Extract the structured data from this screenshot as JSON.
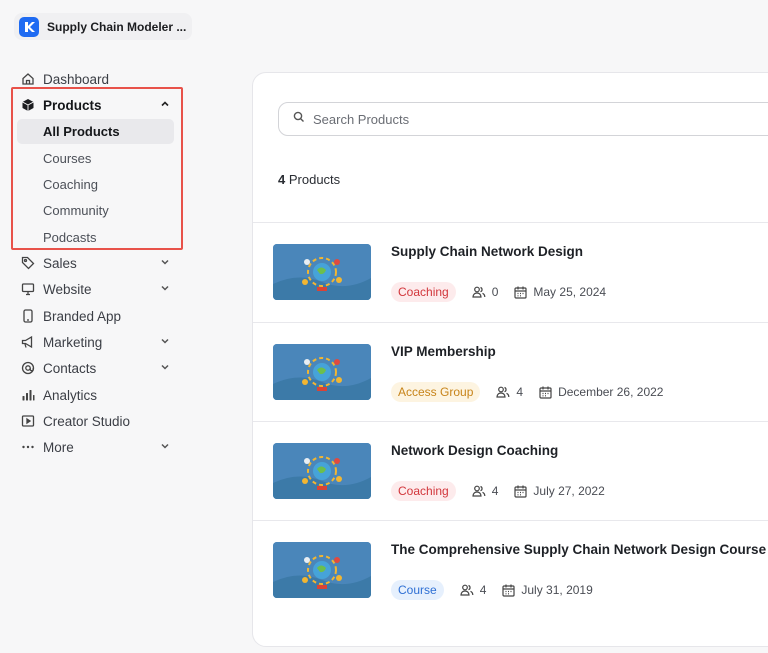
{
  "brand": {
    "name": "Supply Chain Modeler ...",
    "logo_color": "#1f6bf2"
  },
  "sidebar": {
    "items": [
      {
        "label": "Dashboard",
        "icon": "home-icon"
      },
      {
        "label": "Products",
        "icon": "box-icon",
        "expanded": true
      },
      {
        "label": "Sales",
        "icon": "tag-icon",
        "chevron": true
      },
      {
        "label": "Website",
        "icon": "monitor-icon",
        "chevron": true
      },
      {
        "label": "Branded App",
        "icon": "phone-icon"
      },
      {
        "label": "Marketing",
        "icon": "megaphone-icon",
        "chevron": true
      },
      {
        "label": "Contacts",
        "icon": "at-icon",
        "chevron": true
      },
      {
        "label": "Analytics",
        "icon": "bar-chart-icon"
      },
      {
        "label": "Creator Studio",
        "icon": "video-icon"
      },
      {
        "label": "More",
        "icon": "dots-icon",
        "chevron": true
      }
    ],
    "product_subitems": [
      "All Products",
      "Courses",
      "Coaching",
      "Community",
      "Podcasts"
    ],
    "active_subitem": "All Products",
    "highlight_color": "#e8524a"
  },
  "main": {
    "search_placeholder": "Search Products",
    "count_number": "4",
    "count_label": "Products",
    "products": [
      {
        "title": "Supply Chain Network Design",
        "tag": "Coaching",
        "members": "0",
        "date": "May 25, 2024"
      },
      {
        "title": "VIP Membership",
        "tag": "Access Group",
        "members": "4",
        "date": "December 26, 2022"
      },
      {
        "title": "Network Design Coaching",
        "tag": "Coaching",
        "members": "4",
        "date": "July 27, 2022"
      },
      {
        "title": "The Comprehensive Supply Chain Network Design Course",
        "tag": "Course",
        "members": "4",
        "date": "July 31, 2019"
      }
    ]
  },
  "colors": {
    "coaching": "#d2363b",
    "access_group": "#c7841a",
    "course": "#2e6fd4"
  }
}
